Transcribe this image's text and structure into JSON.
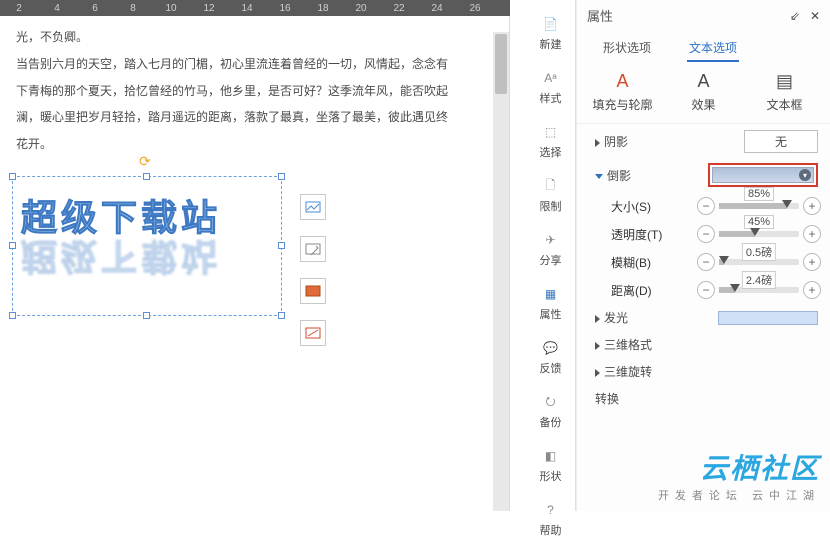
{
  "ruler": {
    "ticks": [
      "2",
      "4",
      "6",
      "8",
      "10",
      "12",
      "14",
      "16",
      "18",
      "20",
      "22",
      "24",
      "26",
      "2"
    ]
  },
  "doc": {
    "p1": "光，不负卿。",
    "p2": "当告别六月的天空，踏入七月的门楣，初心里流连着曾经的一切，风情起，念念有",
    "p3": "下青梅的那个夏天，拾忆曾经的竹马，他乡里，是否可好？这季流年风，能否吹起",
    "p4": "澜，暖心里把岁月轻拾，踏月遥远的距离，落款了最真，坐落了最美，彼此遇见终",
    "p5": "花开。"
  },
  "wordart": {
    "text": "超级下载站"
  },
  "side": {
    "new": "新建",
    "style": "样式",
    "select": "选择",
    "limit": "限制",
    "share": "分享",
    "prop": "属性",
    "feedback": "反馈",
    "backup": "备份",
    "shape": "形状",
    "help": "帮助"
  },
  "prop": {
    "title": "属性",
    "tab_shape": "形状选项",
    "tab_text": "文本选项",
    "t2_fill": "填充与轮廓",
    "t2_effect": "效果",
    "t2_textbox": "文本框",
    "shadow": "阴影",
    "none": "无",
    "reflection": "倒影",
    "size_l": "大小(S)",
    "size_v": "85%",
    "opacity_l": "透明度(T)",
    "opacity_v": "45%",
    "blur_l": "模糊(B)",
    "blur_v": "0.5磅",
    "distance_l": "距离(D)",
    "distance_v": "2.4磅",
    "glow": "发光",
    "threeDformat": "三维格式",
    "threeDrotate": "三维旋转",
    "transform": "转换"
  },
  "sliders": {
    "size_pct": 85,
    "opacity_pct": 45,
    "blur_pct": 6,
    "distance_pct": 20
  },
  "watermark": {
    "big": "云栖社区",
    "small": "开发者论坛 云中江湖"
  }
}
